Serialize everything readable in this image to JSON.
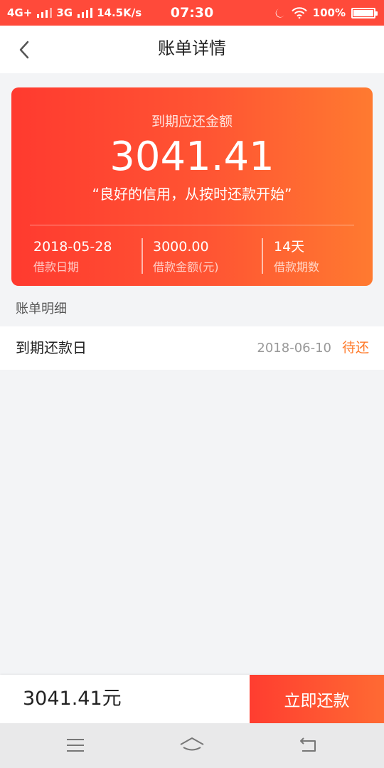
{
  "status_bar": {
    "network_1": "4G+",
    "network_2": "3G",
    "speed": "14.5K/s",
    "time": "07:30",
    "battery": "100%",
    "battery_level": 1.0
  },
  "header": {
    "title": "账单详情"
  },
  "card": {
    "label": "到期应还金额",
    "amount": "3041.41",
    "slogan": "“良好的信用，从按时还款开始”",
    "stats": [
      {
        "value": "2018-05-28",
        "label": "借款日期"
      },
      {
        "value": "3000.00",
        "label": "借款金额(元)"
      },
      {
        "value": "14天",
        "label": "借款期数"
      }
    ]
  },
  "section": {
    "title": "账单明细"
  },
  "detail": {
    "label": "到期还款日",
    "date": "2018-06-10",
    "status": "待还"
  },
  "bottom": {
    "total": "3041.41元",
    "pay_button": "立即还款"
  },
  "colors": {
    "accent": "#ff4a3a",
    "status_pending": "#ff7a2a"
  },
  "icons": {
    "back": "chevron-left-icon",
    "nav_menu": "menu-icon",
    "nav_home": "home-icon",
    "nav_back": "back-arrow-icon"
  }
}
